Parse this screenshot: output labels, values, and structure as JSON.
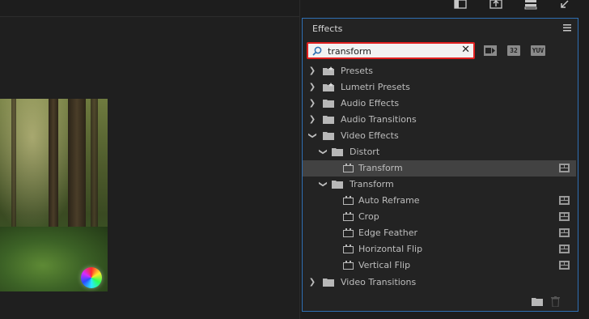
{
  "effects_panel": {
    "title": "Effects",
    "menu_icon": "hamburger-menu-icon",
    "search": {
      "value": "transform",
      "placeholder": ""
    },
    "filters": [
      "accelerated-effects-icon",
      "32",
      "YUV"
    ],
    "tree": [
      {
        "label": "Presets",
        "type": "star-folder",
        "level": 0,
        "expanded": false
      },
      {
        "label": "Lumetri Presets",
        "type": "star-folder",
        "level": 0,
        "expanded": false
      },
      {
        "label": "Audio Effects",
        "type": "folder",
        "level": 0,
        "expanded": false
      },
      {
        "label": "Audio Transitions",
        "type": "folder",
        "level": 0,
        "expanded": false
      },
      {
        "label": "Video Effects",
        "type": "folder",
        "level": 0,
        "expanded": true
      },
      {
        "label": "Distort",
        "type": "folder",
        "level": 1,
        "expanded": true
      },
      {
        "label": "Transform",
        "type": "effect",
        "level": 2,
        "selected": true
      },
      {
        "label": "Transform",
        "type": "folder",
        "level": 1,
        "expanded": true
      },
      {
        "label": "Auto Reframe",
        "type": "effect",
        "level": 2
      },
      {
        "label": "Crop",
        "type": "effect",
        "level": 2
      },
      {
        "label": "Edge Feather",
        "type": "effect",
        "level": 2
      },
      {
        "label": "Horizontal Flip",
        "type": "effect",
        "level": 2
      },
      {
        "label": "Vertical Flip",
        "type": "effect",
        "level": 2
      },
      {
        "label": "Video Transitions",
        "type": "folder",
        "level": 0,
        "expanded": false
      }
    ]
  },
  "colors": {
    "panel_border": "#2f6fb3",
    "search_highlight": "#e02020",
    "selected_row": "#424242"
  }
}
